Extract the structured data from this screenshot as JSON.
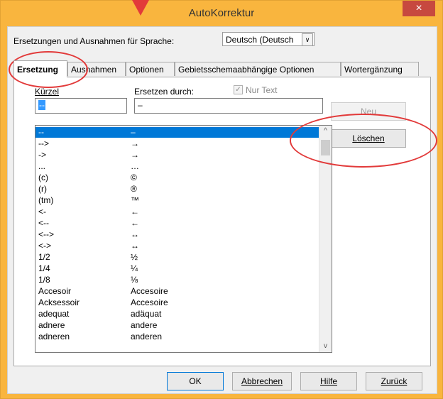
{
  "window": {
    "title": "AutoKorrektur",
    "close_glyph": "×"
  },
  "language": {
    "label": "Ersetzungen und Ausnahmen für Sprache:",
    "selected": "Deutsch (Deutsch",
    "arrow": "∨"
  },
  "tabs": [
    {
      "label": "Ersetzung",
      "active": true
    },
    {
      "label": "Ausnahmen",
      "active": false
    },
    {
      "label": "Optionen",
      "active": false
    },
    {
      "label": "Gebietsschemaabhängige Optionen",
      "active": false
    },
    {
      "label": "Wortergänzung",
      "active": false
    }
  ],
  "fields": {
    "short_label": "Kürzel",
    "replace_label": "Ersetzen durch:",
    "short_value": "--",
    "replace_value": "–",
    "text_only_label": "Nur Text",
    "text_only_checked": true
  },
  "buttons": {
    "new": "Neu",
    "delete": "Löschen"
  },
  "list": {
    "rows": [
      {
        "k": "--",
        "v": "–"
      },
      {
        "k": "-->",
        "v": "→"
      },
      {
        "k": "->",
        "v": "→"
      },
      {
        "k": "...",
        "v": "…"
      },
      {
        "k": "(c)",
        "v": "©"
      },
      {
        "k": "(r)",
        "v": "®"
      },
      {
        "k": "(tm)",
        "v": "™"
      },
      {
        "k": "<-",
        "v": "←"
      },
      {
        "k": "<--",
        "v": "←"
      },
      {
        "k": "<-->",
        "v": "↔"
      },
      {
        "k": "<->",
        "v": "↔"
      },
      {
        "k": "1/2",
        "v": "½"
      },
      {
        "k": "1/4",
        "v": "¼"
      },
      {
        "k": "1/8",
        "v": "⅛"
      },
      {
        "k": "Accesoir",
        "v": "Accesoire"
      },
      {
        "k": "Acksessoir",
        "v": "Accesoire"
      },
      {
        "k": "adequat",
        "v": "adäquat"
      },
      {
        "k": "adnere",
        "v": "andere"
      },
      {
        "k": "adneren",
        "v": "anderen"
      }
    ],
    "selected_index": 0
  },
  "footer": {
    "ok": "OK",
    "cancel": "Abbrechen",
    "help": "Hilfe",
    "back": "Zurück"
  },
  "icons": {
    "scroll_up": "^",
    "scroll_down": "v"
  },
  "colors": {
    "frame": "#f9b53e",
    "close": "#c7483f",
    "annotation": "#e23a3a",
    "selection": "#0078d7"
  }
}
